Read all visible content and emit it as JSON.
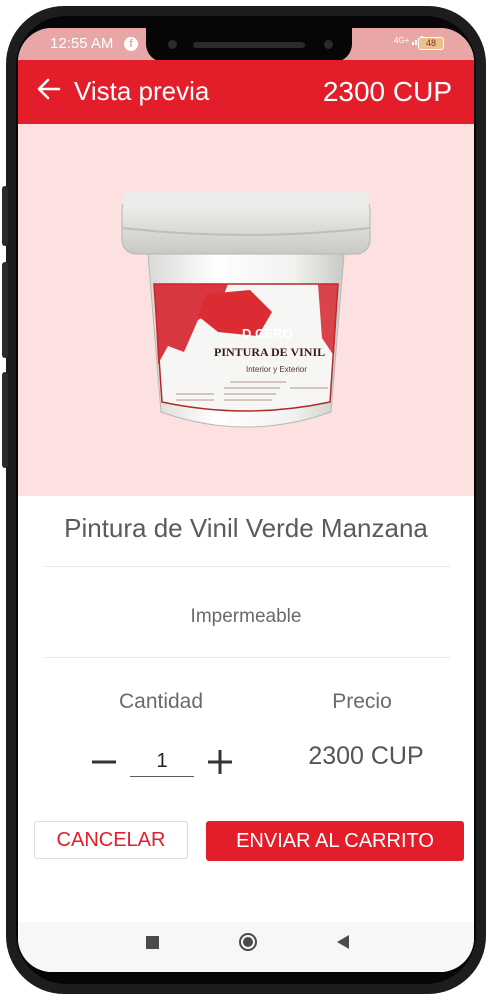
{
  "status_bar": {
    "time": "12:55 AM",
    "network": "4G+",
    "battery": "48"
  },
  "app_bar": {
    "title": "Vista previa",
    "price": "2300 CUP"
  },
  "product": {
    "brand": "D CERO",
    "label_title": "PINTURA DE VINIL",
    "label_subtitle": "Interior y Exterior",
    "name": "Pintura de Vinil Verde Manzana",
    "description": "Impermeable"
  },
  "quantity": {
    "label": "Cantidad",
    "value": "1"
  },
  "price": {
    "label": "Precio",
    "value": "2300 CUP"
  },
  "actions": {
    "cancel": "CANCELAR",
    "add_to_cart": "ENVIAR AL CARRITO"
  },
  "colors": {
    "accent": "#e41d2b",
    "hero_background": "#fde0e0",
    "status_bar": "#e8a6a6"
  },
  "icons": {
    "back": "arrow-left-icon",
    "minus": "minus-icon",
    "plus": "plus-icon",
    "nav_recents": "square-icon",
    "nav_home": "circle-icon",
    "nav_back": "triangle-back-icon"
  }
}
